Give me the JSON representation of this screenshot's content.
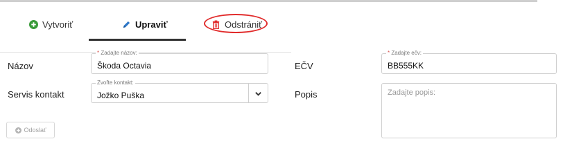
{
  "tabs": {
    "create_label": "Vytvoriť",
    "edit_label": "Upraviť",
    "delete_label": "Odstrániť"
  },
  "form": {
    "name": {
      "label": "Názov",
      "legend_required": "*",
      "legend": " Zadajte názov:",
      "value": "Škoda Octavia"
    },
    "plate": {
      "label": "EČV",
      "legend_required": "*",
      "legend": " Zadajte ečv:",
      "value": "BB555KK"
    },
    "service_contact": {
      "label": "Servis kontakt",
      "legend": "Zvoľte kontakt:",
      "value": "Jožko Puška"
    },
    "description": {
      "label": "Popis",
      "placeholder": "Zadajte popis:"
    }
  },
  "submit_label": "Odoslať",
  "colors": {
    "accent_green": "#3a9b3a",
    "accent_blue": "#2f79c9",
    "delete_red": "#e12b2b",
    "required_red": "#d9534f"
  },
  "icons": {
    "create": "plus-circle-icon",
    "edit": "pencil-icon",
    "delete": "trash-icon",
    "chevron": "chevron-down-icon",
    "submit": "plus-circle-icon"
  }
}
